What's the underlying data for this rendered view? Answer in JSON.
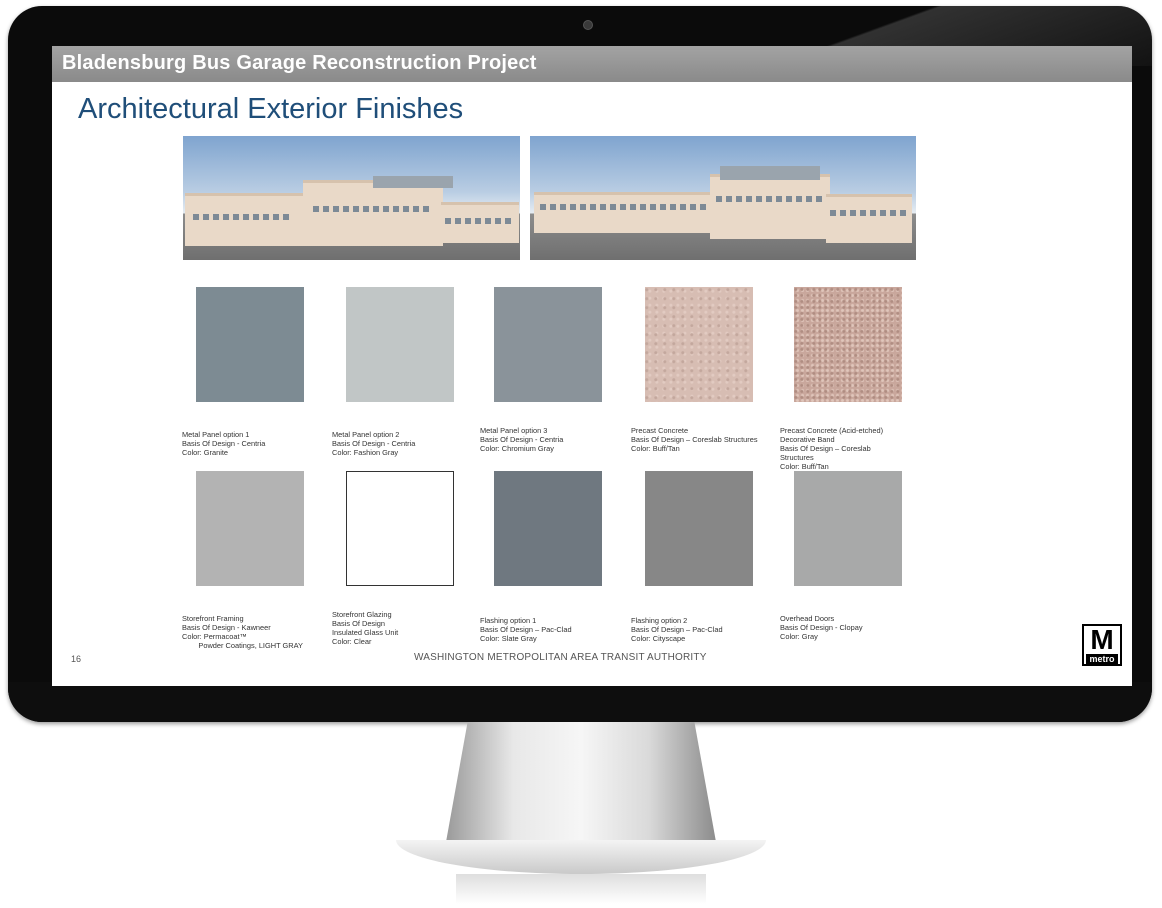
{
  "slide": {
    "header_title": "Bladensburg Bus Garage Reconstruction Project",
    "heading": "Architectural Exterior Finishes",
    "page_number": "16",
    "footer": "WASHINGTON METROPOLITAN AREA TRANSIT AUTHORITY",
    "logo": {
      "letter": "M",
      "word": "metro"
    }
  },
  "swatches": [
    {
      "color": "#7d8b93",
      "lines": [
        "Metal Panel option 1",
        "Basis Of Design - Centria",
        "Color: Granite"
      ]
    },
    {
      "color": "#c1c6c6",
      "lines": [
        "Metal Panel option 2",
        "Basis Of Design - Centria",
        "Color: Fashion Gray"
      ]
    },
    {
      "color": "#8a939a",
      "lines": [
        "Metal Panel option 3",
        "Basis Of Design - Centria",
        "Color: Chromium Gray"
      ]
    },
    {
      "color": "#d7bdb3",
      "lines": [
        "Precast Concrete",
        "Basis Of Design – Coreslab Structures",
        "Color: Buff/Tan"
      ]
    },
    {
      "color": "#c9a79c",
      "lines": [
        "Precast Concrete (Acid-etched)",
        "Decorative Band",
        "Basis Of Design – Coreslab",
        "Structures",
        "Color: Buff/Tan"
      ]
    },
    {
      "color": "#b3b3b3",
      "lines": [
        "Storefront Framing",
        "Basis Of Design - Kawneer",
        "Color: Permacoat™",
        "        Powder Coatings, LIGHT GRAY"
      ]
    },
    {
      "color": "#ffffff",
      "lines": [
        "Storefront Glazing",
        "Basis Of Design",
        "Insulated Glass Unit",
        "Color: Clear"
      ]
    },
    {
      "color": "#6f7880",
      "lines": [
        "Flashing option 1",
        "Basis Of Design – Pac-Clad",
        "Color: Slate Gray"
      ]
    },
    {
      "color": "#878787",
      "lines": [
        "Flashing option 2",
        "Basis Of Design – Pac-Clad",
        "Color: Cityscape"
      ]
    },
    {
      "color": "#a8a9a9",
      "lines": [
        "Overhead Doors",
        "Basis Of Design - Clopay",
        "Color: Gray"
      ]
    }
  ]
}
